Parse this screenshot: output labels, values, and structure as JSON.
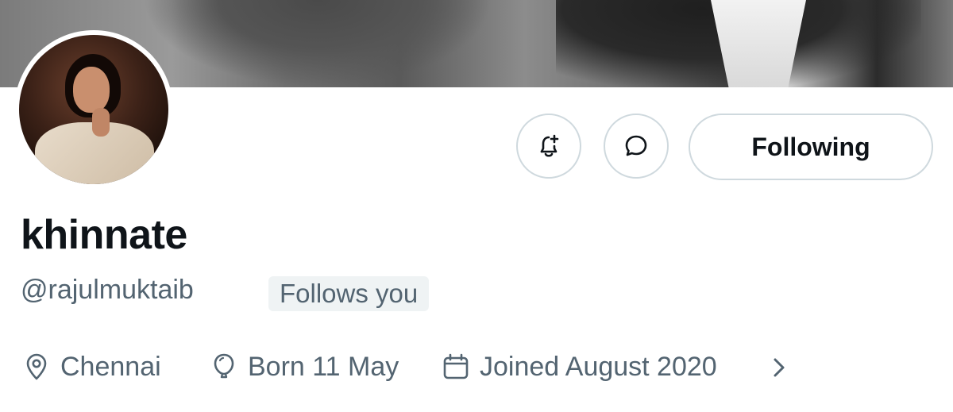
{
  "profile": {
    "display_name": "khinnate",
    "handle": "@rajulmuktaib",
    "follows_you_label": "Follows you",
    "location": "Chennai",
    "birthday": "Born 11 May",
    "joined": "Joined August 2020"
  },
  "actions": {
    "notify_icon": "bell-plus-icon",
    "message_icon": "message-bubble-icon",
    "following_label": "Following"
  },
  "icons": {
    "location": "location-pin-icon",
    "birthday": "balloon-icon",
    "joined": "calendar-icon",
    "more": "chevron-right-icon"
  },
  "colors": {
    "primary_text": "#0f1419",
    "secondary_text": "#536471",
    "border": "#cfd9de",
    "badge_bg": "#eff3f4"
  }
}
